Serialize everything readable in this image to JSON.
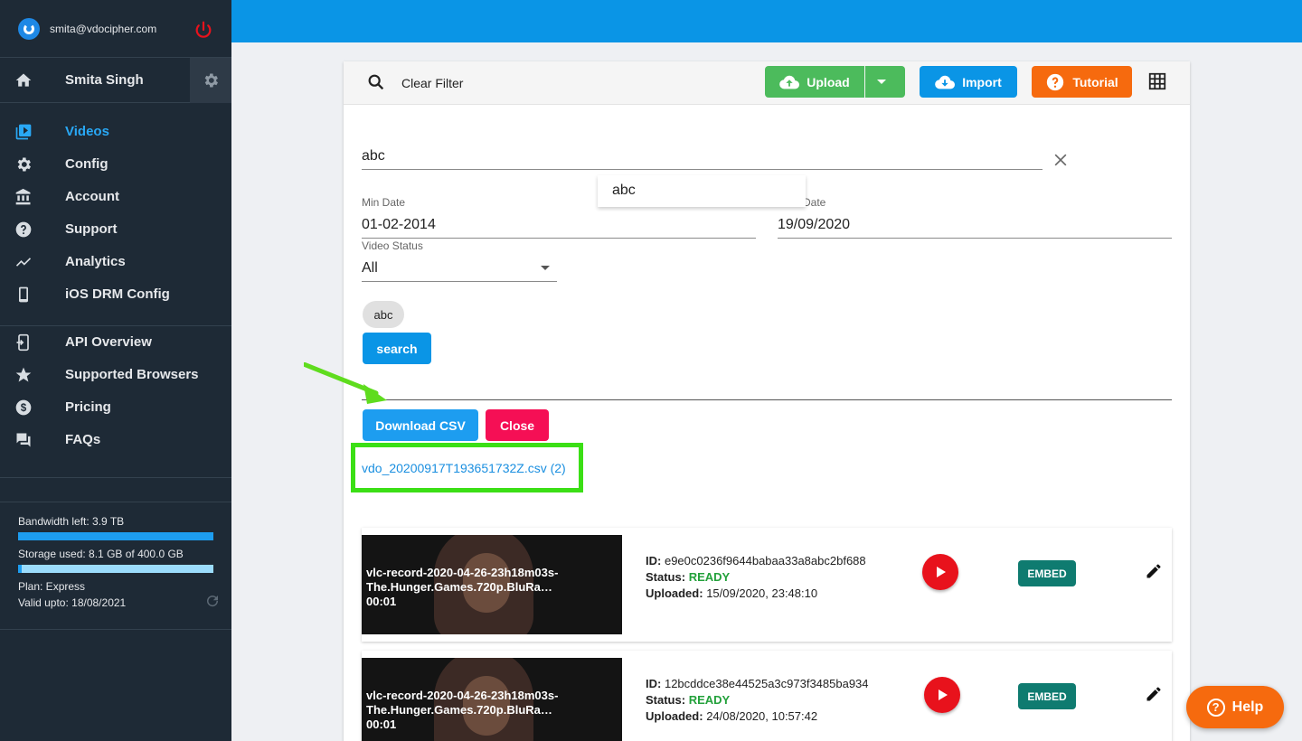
{
  "sidebar": {
    "email": "smita@vdocipher.com",
    "user_name": "Smita Singh",
    "nav_main": [
      {
        "label": "Videos",
        "icon": "video-library-icon",
        "active": true
      },
      {
        "label": "Config",
        "icon": "gear-icon"
      },
      {
        "label": "Account",
        "icon": "bank-icon"
      },
      {
        "label": "Support",
        "icon": "help-circle-icon"
      },
      {
        "label": "Analytics",
        "icon": "trend-line-icon"
      },
      {
        "label": "iOS DRM Config",
        "icon": "phone-icon"
      }
    ],
    "nav_secondary": [
      {
        "label": "API Overview",
        "icon": "api-icon"
      },
      {
        "label": "Supported Browsers",
        "icon": "star-icon"
      },
      {
        "label": "Pricing",
        "icon": "dollar-icon"
      },
      {
        "label": "FAQs",
        "icon": "forum-icon"
      }
    ],
    "stats": {
      "bandwidth": "Bandwidth left: 3.9 TB",
      "bandwidth_fraction": 1.0,
      "storage": "Storage used: 8.1 GB of 400.0 GB",
      "storage_fraction": 0.02,
      "plan": "Plan: Express",
      "valid": "Valid upto: 18/08/2021"
    }
  },
  "toolbar": {
    "clear_filter": "Clear Filter",
    "upload": "Upload",
    "import": "Import",
    "tutorial": "Tutorial"
  },
  "filters": {
    "search_value": "abc",
    "suggestion": "abc",
    "min_date_label": "Min Date",
    "min_date": "01-02-2014",
    "max_date_label_visible": "Date",
    "max_date": "19/09/2020",
    "status_label": "Video Status",
    "status_value": "All",
    "chip": "abc",
    "search_button": "search"
  },
  "csv": {
    "download_label": "Download CSV",
    "close_label": "Close",
    "file_link": "vdo_20200917T193651732Z.csv (2)"
  },
  "videos": [
    {
      "title": "vlc-record-2020-04-26-23h18m03s-The.Hunger.Games.720p.BluRa…",
      "duration": "00:01",
      "id": "e9e0c0236f9644babaa33a8abc2bf688",
      "status": "READY",
      "uploaded": "15/09/2020, 23:48:10",
      "embed": "EMBED"
    },
    {
      "title": "vlc-record-2020-04-26-23h18m03s-The.Hunger.Games.720p.BluRa…",
      "duration": "00:01",
      "id": "12bcddce38e44525a3c973f3485ba934",
      "status": "READY",
      "uploaded": "24/08/2020, 10:57:42",
      "embed": "EMBED"
    }
  ],
  "meta_labels": {
    "id": "ID",
    "status": "Status",
    "uploaded": "Uploaded"
  },
  "help": {
    "label": "Help"
  },
  "colors": {
    "topbar": "#0a95e6",
    "sidebar": "#1e2a36",
    "upload": "#4cbb5c",
    "tutorial": "#f66a0e",
    "close": "#f50f55",
    "highlight": "#3bdf15"
  }
}
